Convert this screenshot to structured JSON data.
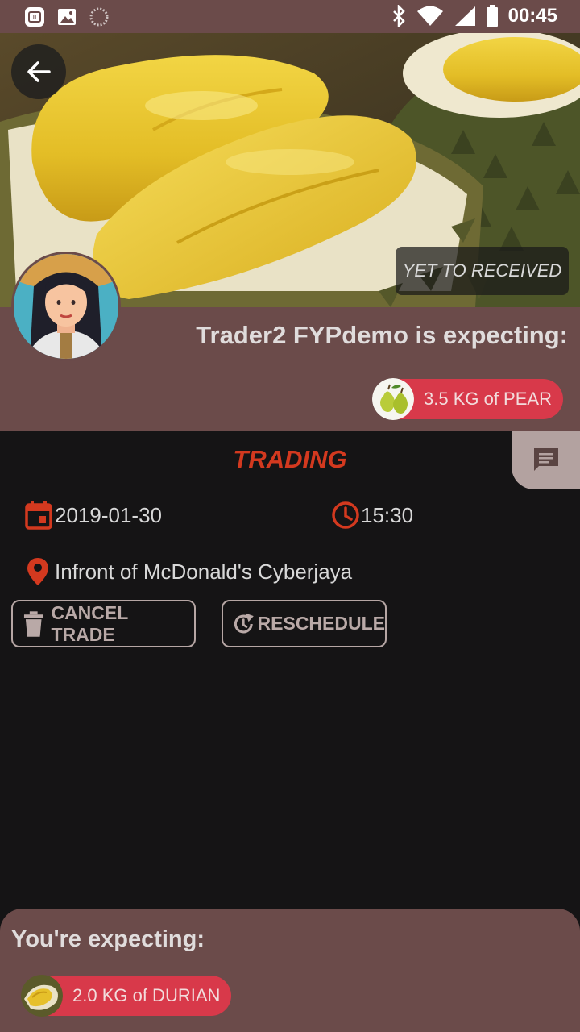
{
  "status_bar": {
    "time": "00:45",
    "left_icons": [
      "notification-app-icon",
      "image-icon",
      "sync-icon"
    ],
    "right_icons": [
      "bluetooth-icon",
      "wifi-icon",
      "cellular-icon",
      "battery-icon"
    ]
  },
  "hero": {
    "image": "durian-fruit-photo",
    "status_chip": "YET TO RECEIVED"
  },
  "trader": {
    "title": "Trader2 FYPdemo is expecting:",
    "item": {
      "label": "3.5 KG of PEAR",
      "thumbnail": "pear-thumbnail"
    }
  },
  "trade": {
    "status": "TRADING",
    "date": "2019-01-30",
    "time": "15:30",
    "location": "Infront of McDonald's Cyberjaya"
  },
  "actions": {
    "cancel_label": "CANCEL TRADE",
    "reschedule_label": "RESCHEDULE"
  },
  "you": {
    "title": "You're expecting:",
    "item": {
      "label": "2.0 KG of DURIAN",
      "thumbnail": "durian-thumbnail"
    }
  },
  "colors": {
    "panel": "#6b4b4a",
    "background": "#151415",
    "accent_red": "#d3391f",
    "chip_red": "#d8394a",
    "chat_tab": "#b3a2a0"
  }
}
